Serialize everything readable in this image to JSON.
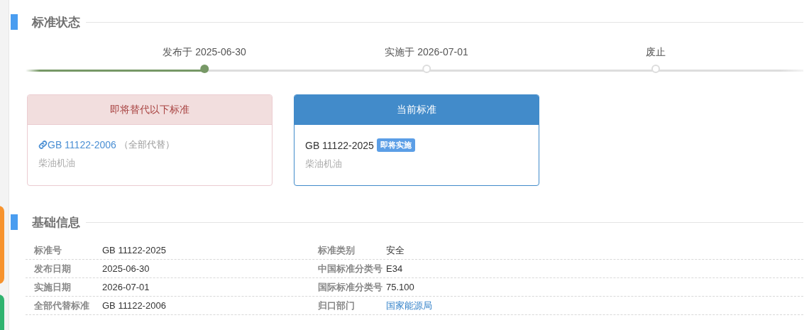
{
  "status_section": {
    "title": "标准状态",
    "timeline": [
      {
        "label": "发布于 2025-06-30",
        "reached": true
      },
      {
        "label": "实施于 2026-07-01",
        "reached": false
      },
      {
        "label": "废止",
        "reached": false
      }
    ],
    "cards": [
      {
        "kind": "replaced",
        "header": "即将替代以下标准",
        "code": "GB 11122-2006",
        "note": "（全部代替）",
        "description": "柴油机油"
      },
      {
        "kind": "current",
        "header": "当前标准",
        "code": "GB 11122-2025",
        "badge": "即将实施",
        "description": "柴油机油"
      }
    ]
  },
  "info_section": {
    "title": "基础信息",
    "rows": [
      {
        "left": {
          "label": "标准号",
          "value": "GB 11122-2025",
          "kind": "text"
        },
        "right": {
          "label": "标准类别",
          "value": "安全",
          "kind": "text"
        }
      },
      {
        "left": {
          "label": "发布日期",
          "value": "2025-06-30",
          "kind": "text"
        },
        "right": {
          "label": "中国标准分类号",
          "value": "E34",
          "kind": "text"
        }
      },
      {
        "left": {
          "label": "实施日期",
          "value": "2026-07-01",
          "kind": "text"
        },
        "right": {
          "label": "国际标准分类号",
          "value": "75.100",
          "kind": "text"
        }
      },
      {
        "left": {
          "label": "全部代替标准",
          "value": "GB 11122-2006",
          "kind": "text"
        },
        "right": {
          "label": "归口部门",
          "value": "国家能源局",
          "kind": "link"
        }
      }
    ]
  }
}
